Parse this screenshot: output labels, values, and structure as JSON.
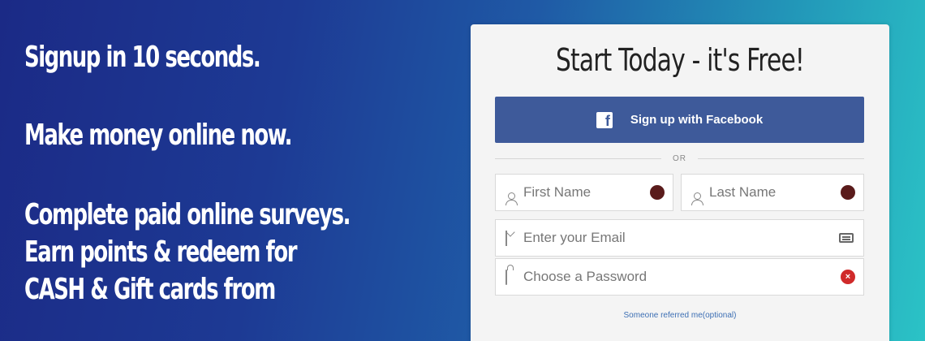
{
  "promo": {
    "line1": "Signup in 10 seconds.",
    "line2": "Make money online now.",
    "line3": "Complete paid online surveys.",
    "line4": "Earn points & redeem for",
    "line5": "CASH & Gift cards from"
  },
  "signup": {
    "title": "Start Today - it's Free!",
    "facebook_label": "Sign up with Facebook",
    "facebook_glyph": "f",
    "divider_text": "OR",
    "first_name_placeholder": "First Name",
    "last_name_placeholder": "Last Name",
    "email_placeholder": "Enter your Email",
    "password_placeholder": "Choose a Password",
    "password_error_glyph": "×",
    "referred_link": "Someone referred me(optional)"
  },
  "icons": {
    "first_name": "user-icon",
    "last_name": "user-icon",
    "email": "mail-icon",
    "password": "lock-icon",
    "facebook": "facebook-icon"
  },
  "colors": {
    "facebook_blue": "#3e5a9a",
    "error_red": "#d02a2a",
    "link_blue": "#3d6fb4"
  }
}
